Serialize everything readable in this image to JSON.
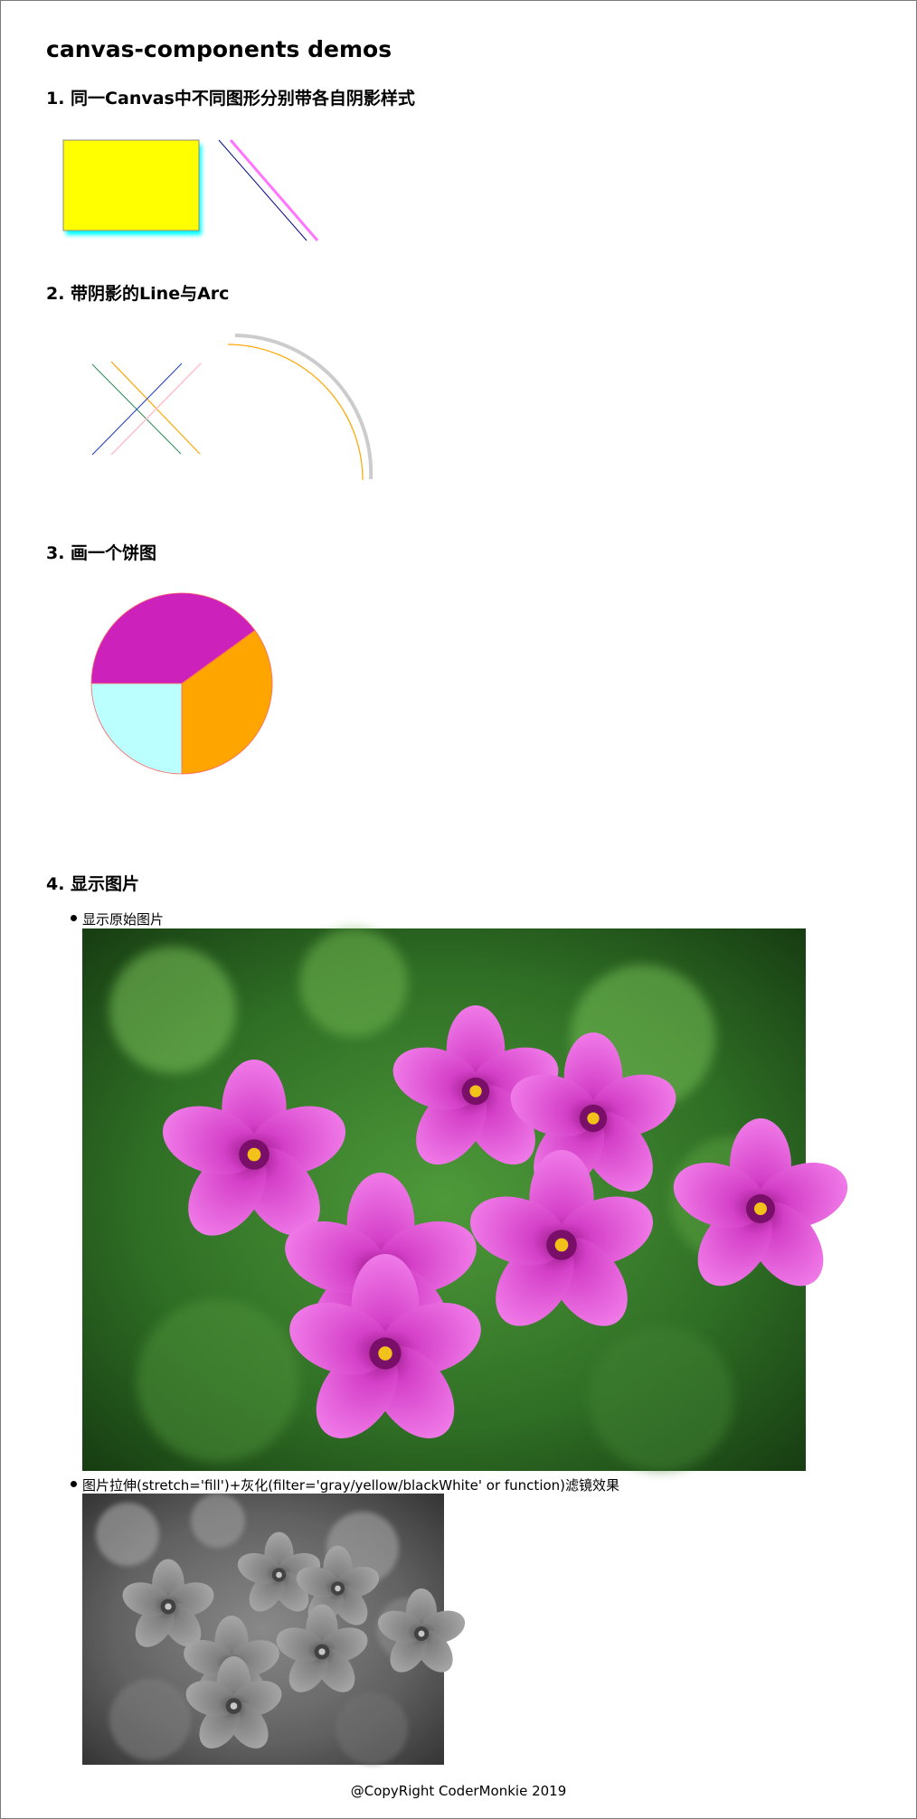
{
  "page": {
    "title": "canvas-components demos",
    "footer": "@CopyRight CoderMonkie 2019"
  },
  "sections": [
    {
      "title": "1. 同一Canvas中不同图形分别带各自阴影样式"
    },
    {
      "title": "2. 带阴影的Line与Arc"
    },
    {
      "title": "3. 画一个饼图"
    },
    {
      "title": "4. 显示图片"
    }
  ],
  "images_section": {
    "items": [
      {
        "label": "显示原始图片",
        "image": "pink-oxalis-flowers-photo",
        "filter": "none"
      },
      {
        "label": "图片拉伸(stretch='fill')+灰化(filter='gray/yellow/blackWhite' or function)滤镜效果",
        "image": "pink-oxalis-flowers-photo",
        "filter": "gray"
      }
    ]
  },
  "colors": {
    "rect_fill": "#ffff00",
    "rect_shadow": "#00ffff",
    "line_blue": "#00008b",
    "line_pink": "#ff66ff",
    "line_green": "#2e8b57",
    "line_orange": "#ffa500",
    "line_lightpink": "#ffc0cb",
    "arc_orange": "#ffa500",
    "arc_shadow": "#cccccc",
    "pie_magenta": "#cc22bb",
    "pie_orange": "#ffa500",
    "pie_cyan": "#bbffff",
    "pie_stroke": "#ff6666"
  },
  "chart_data": {
    "type": "pie",
    "title": "",
    "slices": [
      {
        "value": 0.4,
        "color": "#cc22bb"
      },
      {
        "value": 0.35,
        "color": "#ffa500"
      },
      {
        "value": 0.25,
        "color": "#bbffff"
      }
    ]
  }
}
